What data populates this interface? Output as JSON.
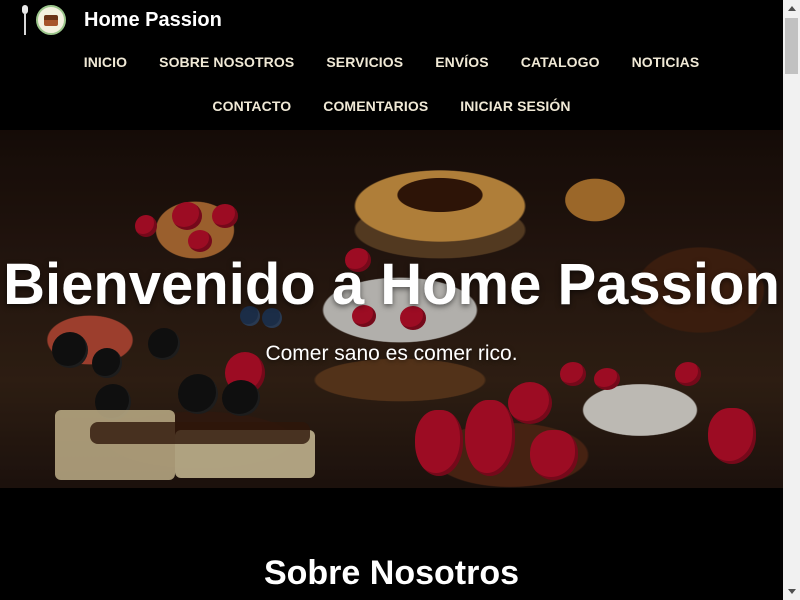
{
  "header": {
    "brand_name": "Home Passion",
    "logo_icon": "spoon-plate-logo-icon"
  },
  "nav": {
    "row1": [
      "INICIO",
      "SOBRE NOSOTROS",
      "SERVICIOS",
      "ENVÍOS",
      "CATALOGO",
      "NOTICIAS"
    ],
    "row2": [
      "CONTACTO",
      "COMENTARIOS",
      "INICIAR SESIÓN"
    ]
  },
  "hero": {
    "title": "Bienvenido a Home Passion",
    "subtitle": "Comer sano es comer rico."
  },
  "about": {
    "title": "Sobre Nosotros"
  },
  "colors": {
    "background": "#000000",
    "nav_text": "#f0e9d6",
    "heading_text": "#ffffff"
  }
}
